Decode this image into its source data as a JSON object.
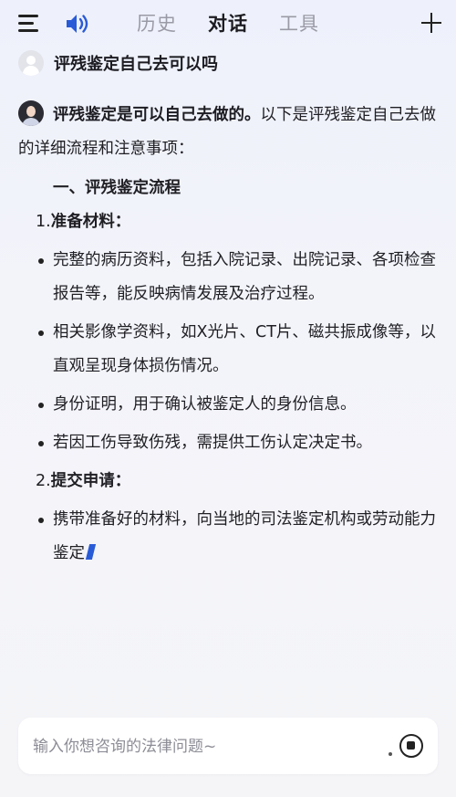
{
  "header": {
    "tabs": [
      {
        "label": "历史",
        "active": false
      },
      {
        "label": "对话",
        "active": true
      },
      {
        "label": "工具",
        "active": false
      }
    ],
    "accent_color": "#2a5bd7"
  },
  "question": {
    "text": "评残鉴定自己去可以吗"
  },
  "answer": {
    "intro_bold": "评残鉴定是可以自己去做的。",
    "intro_rest": "以下是评残鉴定自己去做的详细流程和注意事项：",
    "section_title": "一、评残鉴定流程",
    "steps": [
      {
        "num": "1.",
        "label": "准备材料：",
        "bullets": [
          "完整的病历资料，包括入院记录、出院记录、各项检查报告等，能反映病情发展及治疗过程。",
          "相关影像学资料，如X光片、CT片、磁共振成像等，以直观呈现身体损伤情况。",
          "身份证明，用于确认被鉴定人的身份信息。",
          "若因工伤导致伤残，需提供工伤认定决定书。"
        ]
      },
      {
        "num": "2.",
        "label": "提交申请：",
        "bullets": [
          "携带准备好的材料，向当地的司法鉴定机构或劳动能力鉴定"
        ]
      }
    ]
  },
  "input": {
    "placeholder": "输入你想咨询的法律问题~"
  },
  "icons": [
    "menu-icon",
    "speaker-icon",
    "plus-icon",
    "user-avatar-icon",
    "bot-avatar-icon",
    "stop-icon"
  ]
}
